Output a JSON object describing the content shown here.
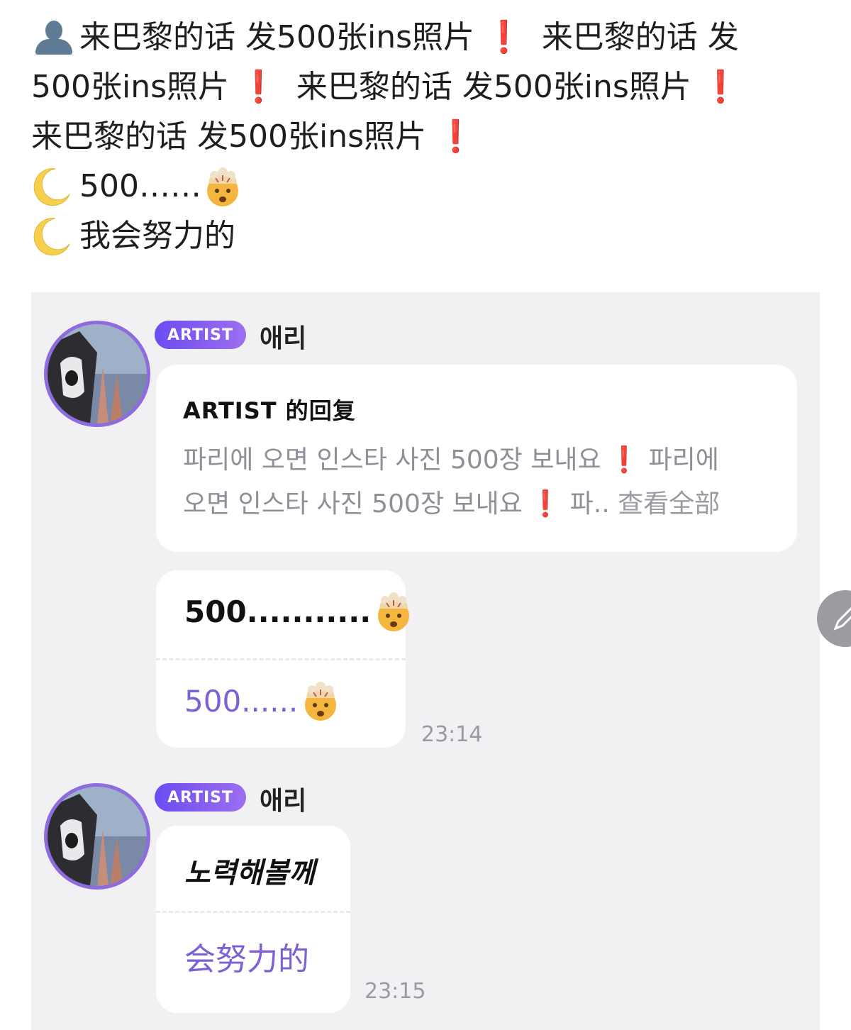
{
  "caption": {
    "phrase": "来巴黎的话 发500张ins照片",
    "exclaim": "❗",
    "line1_a": "来巴黎的话 发500张ins照片",
    "line1_b": "来巴黎的话 发",
    "line2_a": "500张ins照片",
    "line2_b": "来巴黎的话 发500张ins照片",
    "line3_a": "来巴黎的话 发500张ins照片",
    "reply1": "500……",
    "reply2": "我会努力的"
  },
  "thread": {
    "messages": [
      {
        "badge": "ARTIST",
        "sender": "애리",
        "reply_title": "ARTIST 的回复",
        "reply_line1_a": "파리에 오면 인스타 사진 500장 보내요",
        "reply_line1_b": "파리에",
        "reply_line2_a": "오면 인스타 사진 500장 보내요",
        "reply_line2_b": "파..",
        "reply_more": "查看全部",
        "text": "500...........",
        "translation": "500......",
        "time": "23:14"
      },
      {
        "badge": "ARTIST",
        "sender": "애리",
        "text": "노력해볼께",
        "translation": "会努力的",
        "time": "23:15"
      }
    ]
  },
  "icons": {
    "caption_person": "person-icon",
    "moon": "crescent-moon-icon",
    "emoji": "exploding-head-emoji",
    "edit": "pencil-icon"
  },
  "colors": {
    "badge_start": "#6c4cf1",
    "badge_end": "#9d6ff0",
    "translation": "#7d5fd6",
    "exclaim": "#e02020",
    "panel_bg": "#f1f1f3"
  }
}
